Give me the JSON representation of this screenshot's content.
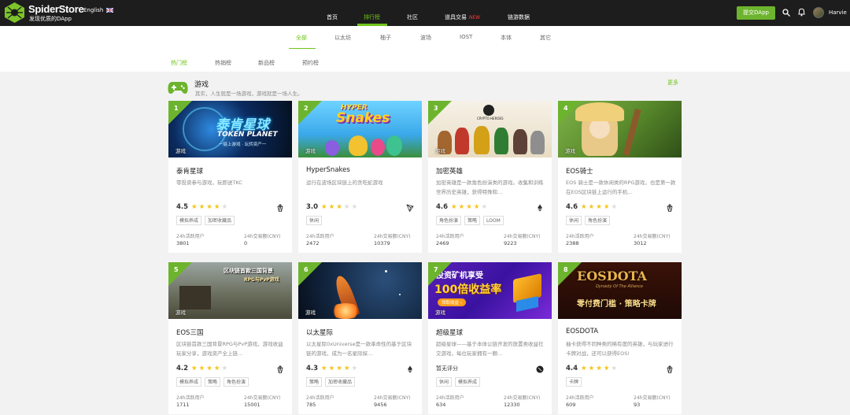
{
  "brand": {
    "name": "SpiderStore",
    "slogan": "发现优质的DApp",
    "language": "English"
  },
  "nav": [
    {
      "label": "首页"
    },
    {
      "label": "排行榜"
    },
    {
      "label": "社区"
    },
    {
      "label": "道具交易",
      "badge": "NEW"
    },
    {
      "label": "链游数据"
    }
  ],
  "header": {
    "submit_label": "提交DApp",
    "username": "Harvie"
  },
  "categories": [
    {
      "label": "全部"
    },
    {
      "label": "以太坊"
    },
    {
      "label": "柚子"
    },
    {
      "label": "波场"
    },
    {
      "label": "IOST"
    },
    {
      "label": "本体"
    },
    {
      "label": "其它"
    }
  ],
  "subtabs": [
    {
      "label": "热门榜"
    },
    {
      "label": "热销榜"
    },
    {
      "label": "新品榜"
    },
    {
      "label": "预约榜"
    }
  ],
  "section": {
    "title": "游戏",
    "subtitle": "其实，人生就是一场游戏，游戏就是一场人生。",
    "more": "更多"
  },
  "stat_labels": {
    "users": "24h活跃用户",
    "volume": "24h交易额(CNY)"
  },
  "colors": {
    "accent": "#6db42e",
    "star": "#f5c518"
  },
  "cards": [
    {
      "rank": "1",
      "image_tag": "游戏",
      "title": "泰肯星球",
      "desc": "零投资参与游戏，玩即送TKC",
      "rating": "4.5",
      "rating_value": 4.5,
      "chain_icon": "eos-icon",
      "tags": [
        "模拟养成",
        "加密收藏品"
      ],
      "users": "3801",
      "volume": "0"
    },
    {
      "rank": "2",
      "image_tag": "游戏",
      "title": "HyperSnakes",
      "desc": "运行在波场区块链上的贪吃蛇游戏",
      "rating": "3.0",
      "rating_value": 3.0,
      "chain_icon": "tron-icon",
      "tags": [
        "休闲"
      ],
      "users": "2472",
      "volume": "10379"
    },
    {
      "rank": "3",
      "image_tag": "游戏",
      "title": "加密英雄",
      "desc": "加密英雄是一款角色扮演类的游戏。收集和训练世界历史英雄，获得特殊和…",
      "rating": "4.6",
      "rating_value": 4.6,
      "chain_icon": "ethereum-icon",
      "tags": [
        "角色扮演",
        "策略",
        "LOOM"
      ],
      "users": "2469",
      "volume": "9223"
    },
    {
      "rank": "4",
      "image_tag": "游戏",
      "title": "EOS骑士",
      "desc": "EOS 骑士是一款休闲类的RPG游戏，也是第一款在EOS区块链上运行的手机…",
      "rating": "4.6",
      "rating_value": 4.6,
      "chain_icon": "eos-icon",
      "tags": [
        "休闲",
        "角色扮演"
      ],
      "users": "2388",
      "volume": "3012"
    },
    {
      "rank": "5",
      "image_tag": "游戏",
      "title": "EOS三国",
      "desc": "区块链首款三国背景RPG与PvP游戏，游戏收益玩家分享，游戏资产全上链…",
      "rating": "4.2",
      "rating_value": 4.2,
      "chain_icon": "eos-icon",
      "tags": [
        "模拟养成",
        "策略",
        "角色扮演"
      ],
      "users": "1711",
      "volume": "15001"
    },
    {
      "rank": "6",
      "image_tag": "游戏",
      "title": "以太星际",
      "desc": "以太星际0xUniverse是一款革命性的基于区块链的游戏，成为一名星际探…",
      "rating": "4.3",
      "rating_value": 4.3,
      "chain_icon": "ethereum-icon",
      "tags": [
        "策略",
        "加密收藏品"
      ],
      "users": "785",
      "volume": "9456"
    },
    {
      "rank": "7",
      "image_tag": "游戏",
      "title": "超级星球",
      "desc": "超级星球——基于本体公链开发的放置类收益社交游戏，每位玩家拥有一颗…",
      "rating": "暂无评分",
      "rating_value": 0,
      "chain_icon": "ontology-icon",
      "tags": [
        "休闲",
        "模拟养成"
      ],
      "users": "634",
      "volume": "12330"
    },
    {
      "rank": "8",
      "image_tag": "游戏",
      "title": "EOSDOTA",
      "desc": "抽卡获得不同种类的稀有度的英雄，与玩家进行卡牌对战，还可以获得EOS!",
      "rating": "4.4",
      "rating_value": 4.4,
      "chain_icon": "eos-icon",
      "tags": [
        "卡牌"
      ],
      "users": "609",
      "volume": "93"
    }
  ],
  "banners": {
    "b1": {
      "line1": "泰肯星球",
      "line2": "TOKEN PLANET",
      "line3": "一链上游戏 · 玩转资产一"
    },
    "b2": {
      "line1": "HYPER",
      "line2": "Snakes"
    },
    "b3": {
      "line1": "CRYPTO HEROES"
    },
    "b5": {
      "line1": "区块链首款三国背景",
      "line2": "RPG与PvP游戏"
    },
    "b7": {
      "line1": "投资矿机享受",
      "line2": "100倍收益率",
      "line3": "领取收益 ›"
    },
    "b8": {
      "line1": "EOSDOTA",
      "line2": "Dynasty Of The Alliance",
      "line3": "零付费门槛 · 策略卡牌"
    }
  }
}
